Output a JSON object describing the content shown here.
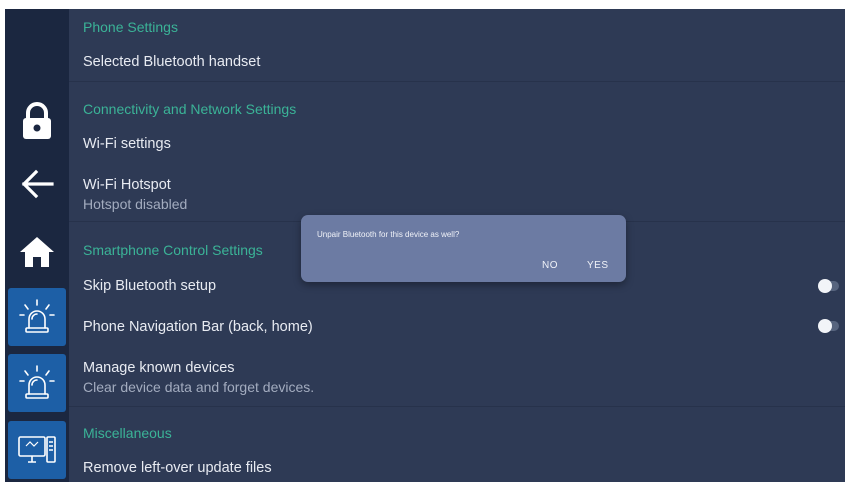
{
  "sections": {
    "phone": {
      "header": "Phone Settings",
      "items": [
        {
          "title": "Selected Bluetooth handset"
        }
      ]
    },
    "connectivity": {
      "header": "Connectivity and Network Settings",
      "items": [
        {
          "title": "Wi-Fi settings"
        },
        {
          "title": "Wi-Fi Hotspot",
          "subtitle": "Hotspot disabled"
        }
      ]
    },
    "smartphone": {
      "header": "Smartphone Control Settings",
      "items": [
        {
          "title": "Skip Bluetooth setup",
          "toggle": "off"
        },
        {
          "title": "Phone Navigation Bar (back, home)",
          "toggle": "off"
        },
        {
          "title": "Manage known devices",
          "subtitle": "Clear device data and forget devices."
        }
      ]
    },
    "misc": {
      "header": "Miscellaneous",
      "items": [
        {
          "title": "Remove left-over update files"
        }
      ]
    }
  },
  "sidebar": {
    "icons": [
      "lock-icon",
      "back-arrow-icon",
      "home-icon",
      "siren-icon",
      "siren-icon",
      "computer-icon"
    ]
  },
  "dialog": {
    "message": "Unpair Bluetooth for this device as well?",
    "no_label": "NO",
    "yes_label": "YES"
  },
  "colors": {
    "background": "#2e3a55",
    "sidebar": "#1b2740",
    "section_header": "#3bb397",
    "dialog": "#6c7ba3",
    "tile": "#1d5fa6"
  }
}
